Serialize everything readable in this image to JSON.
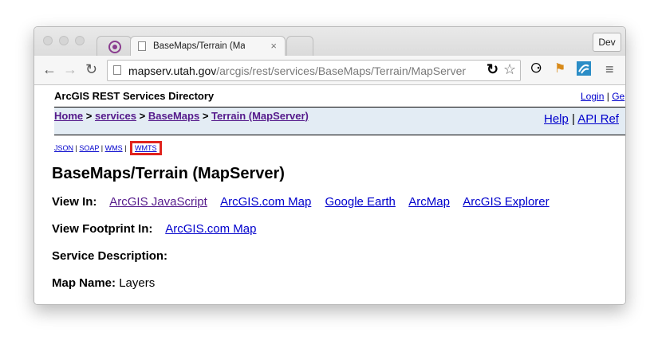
{
  "browser": {
    "tab_title": "BaseMaps/Terrain (MapServer)",
    "tab_close": "×",
    "dev_label": "Dev",
    "url_host": "mapserv.utah.gov",
    "url_path": "/arcgis/rest/services/BaseMaps/Terrain/MapServer",
    "icons": [
      "back-arrow-icon",
      "forward-arrow-icon",
      "reload-icon",
      "page-icon",
      "refresh-extension-icon",
      "star-icon",
      "extension-icon",
      "extension-icon",
      "extension-icon",
      "menu-icon"
    ]
  },
  "header": {
    "title": "ArcGIS REST Services Directory",
    "login": "Login",
    "login_sep": "|",
    "get_token": "Ge"
  },
  "breadcrumb": {
    "home": "Home",
    "services": "services",
    "basemaps": "BaseMaps",
    "terrain": "Terrain (MapServer)",
    "sep": ">"
  },
  "help": {
    "help": "Help",
    "sep": "|",
    "api": "API Ref"
  },
  "formats": {
    "json": "JSON",
    "soap": "SOAP",
    "wms": "WMS",
    "wmts": "WMTS",
    "sep": "|"
  },
  "service": {
    "heading": "BaseMaps/Terrain (MapServer)",
    "view_in_label": "View In:",
    "view_in_links": [
      "ArcGIS JavaScript",
      "ArcGIS.com Map",
      "Google Earth",
      "ArcMap",
      "ArcGIS Explorer"
    ],
    "footprint_label": "View Footprint In:",
    "footprint_link": "ArcGIS.com Map",
    "description_label": "Service Description:",
    "map_name_label": "Map Name:",
    "map_name_value": "Layers"
  },
  "colors": {
    "link": "#0000cc",
    "visited": "#551a8b",
    "highlight": "#e0231d",
    "breadbar": "#e3ecf4"
  }
}
